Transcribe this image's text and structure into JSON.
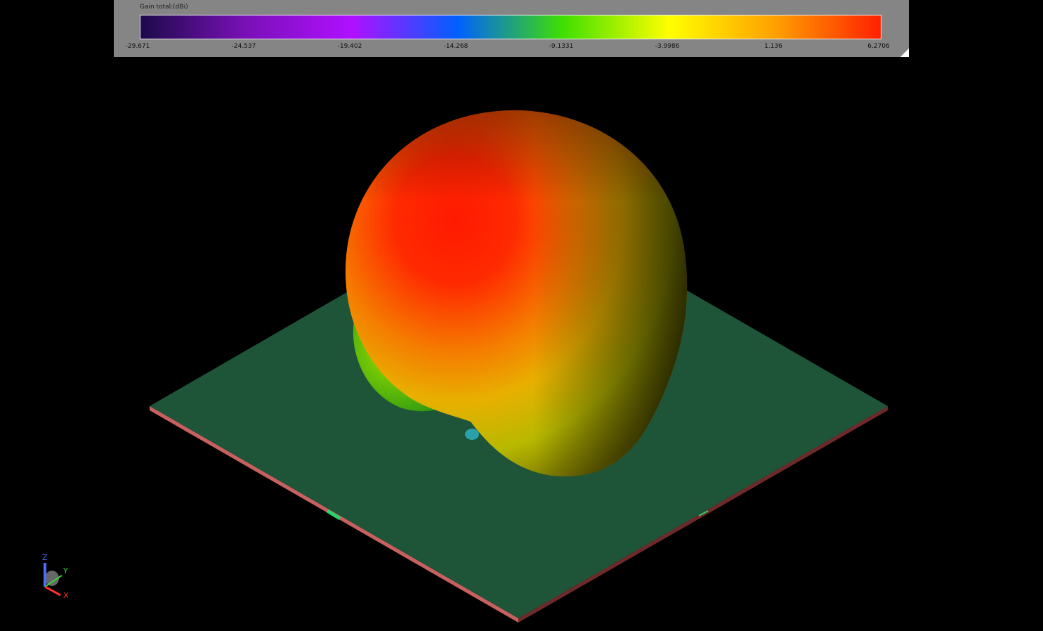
{
  "legend": {
    "title": "Gain total:(dBi)",
    "ticks": [
      "-29.671",
      "-24.537",
      "-19.402",
      "-14.268",
      "-9.1331",
      "-3.9986",
      "1.136",
      "6.2706"
    ],
    "gradient_colors": [
      "#1c0a4a",
      "#7a10b8",
      "#b010ff",
      "#0060ff",
      "#40e000",
      "#ffff00",
      "#ffa000",
      "#ff2000"
    ]
  },
  "axes": {
    "z_label": "Z",
    "y_label": "Y",
    "x_label": "X",
    "z_color": "#4a6cff",
    "y_color": "#3ad13a",
    "x_color": "#ff3030"
  },
  "scene": {
    "substrate_color": "#1e5538",
    "edge_color": "#c86060",
    "port_marker": "1"
  },
  "icons": [
    "axes-orientation-icon",
    "resize-corner-icon"
  ]
}
